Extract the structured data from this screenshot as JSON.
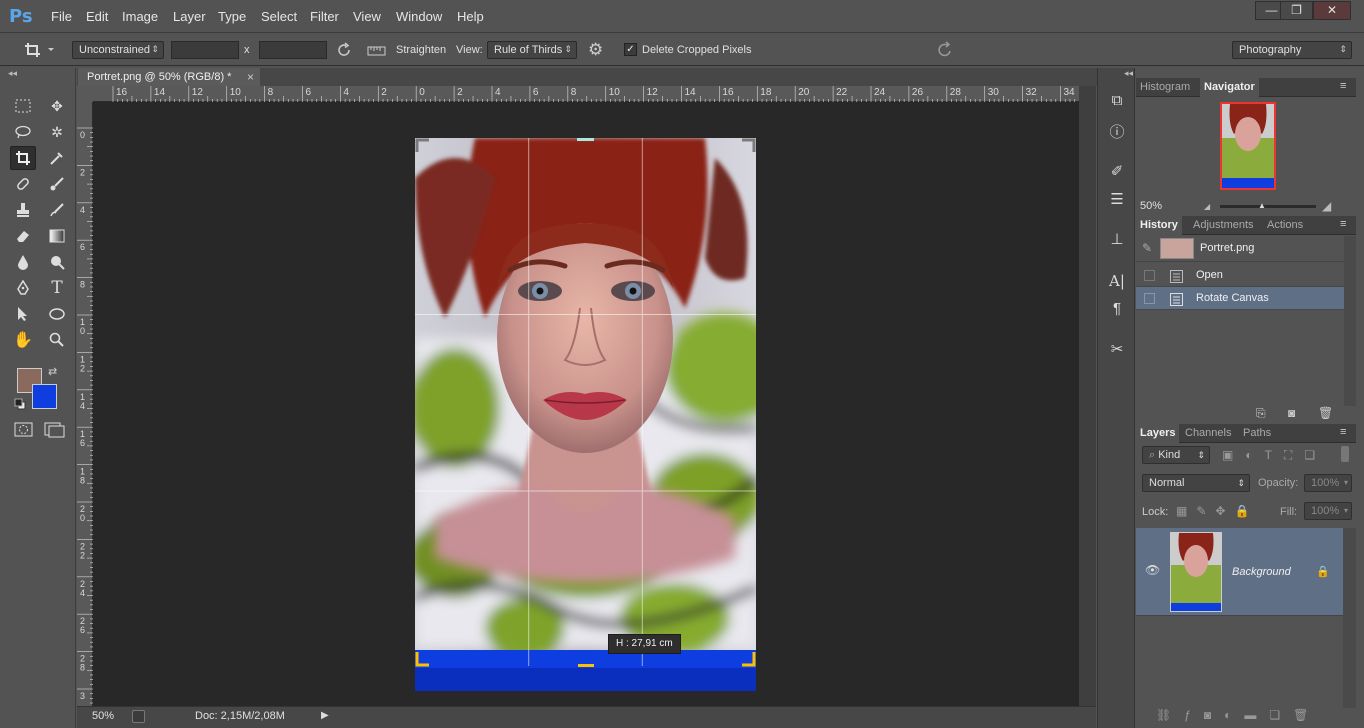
{
  "app": {
    "logo": "Ps"
  },
  "menu": [
    "File",
    "Edit",
    "Image",
    "Layer",
    "Type",
    "Select",
    "Filter",
    "View",
    "Window",
    "Help"
  ],
  "window_controls": {
    "minimize": "—",
    "restore": "❐",
    "close": "✕"
  },
  "options": {
    "ratio": "Unconstrained",
    "x_sep": "x",
    "straighten": "Straighten",
    "view_label": "View:",
    "view_value": "Rule of Thirds",
    "delete_cropped": "Delete Cropped Pixels",
    "delete_cropped_checked": true,
    "workspace": "Photography"
  },
  "document": {
    "tab_title": "Portret.png @ 50% (RGB/8) *",
    "close": "×",
    "ruler_top_labels": [
      "16",
      "14",
      "12",
      "10",
      "8",
      "6",
      "4",
      "2",
      "0",
      "2",
      "4",
      "6",
      "8",
      "10",
      "12",
      "14",
      "16",
      "18",
      "20",
      "22",
      "24",
      "26",
      "28",
      "30",
      "32",
      "34"
    ],
    "ruler_left_labels": [
      "0",
      "2",
      "4",
      "6",
      "8",
      "1\n0",
      "1\n2",
      "1\n4",
      "1\n6",
      "1\n8",
      "2\n0",
      "2\n2",
      "2\n4",
      "2\n6",
      "2\n8",
      "3"
    ],
    "crop_tooltip": "H :  27,91 cm"
  },
  "status": {
    "zoom": "50%",
    "doc": "Doc: 2,15M/2,08M"
  },
  "colors": {
    "foreground": "#8b6a5e",
    "background": "#0f3ee0",
    "selection": "#5f6f85",
    "panel": "#535353"
  },
  "navigator": {
    "tabs": [
      "Histogram",
      "Navigator"
    ],
    "active": "Navigator",
    "zoom": "50%"
  },
  "history": {
    "tabs": [
      "History",
      "Adjustments",
      "Actions"
    ],
    "active": "History",
    "snapshot": "Portret.png",
    "steps": [
      "Open",
      "Rotate Canvas"
    ],
    "selected_step": "Rotate Canvas"
  },
  "layers": {
    "tabs": [
      "Layers",
      "Channels",
      "Paths"
    ],
    "active": "Layers",
    "filter": "Kind",
    "blend_mode": "Normal",
    "opacity_label": "Opacity:",
    "opacity": "100%",
    "lock_label": "Lock:",
    "fill_label": "Fill:",
    "fill": "100%",
    "layer_name": "Background"
  }
}
